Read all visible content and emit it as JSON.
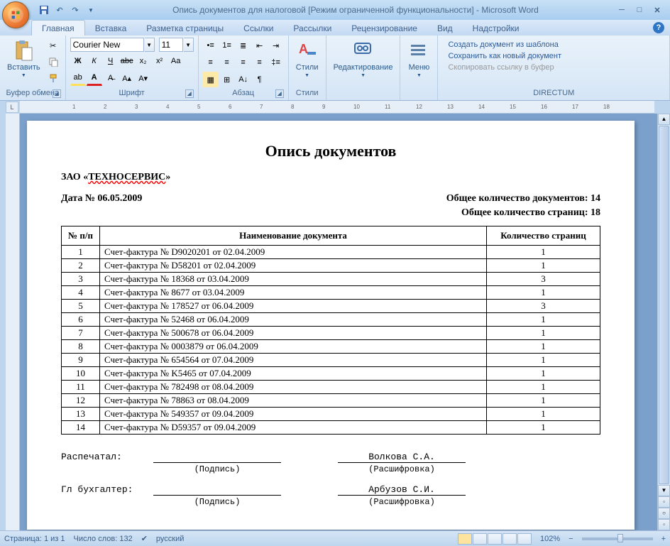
{
  "titlebar": {
    "title": "Опись документов для налоговой [Режим ограниченной функциональности] - Microsoft Word"
  },
  "tabs": {
    "items": [
      "Главная",
      "Вставка",
      "Разметка страницы",
      "Ссылки",
      "Рассылки",
      "Рецензирование",
      "Вид",
      "Надстройки"
    ],
    "active": 0
  },
  "ribbon": {
    "clipboard": {
      "label": "Буфер обмена",
      "paste": "Вставить"
    },
    "font": {
      "label": "Шрифт",
      "name": "Courier New",
      "size": "11"
    },
    "paragraph": {
      "label": "Абзац"
    },
    "styles": {
      "label": "Стили"
    },
    "editing": {
      "label": "Редактирование"
    },
    "menu": {
      "label": "Меню"
    },
    "directum": {
      "label": "DIRECTUM",
      "link1": "Создать документ из шаблона",
      "link2": "Сохранить как новый документ",
      "link3": "Скопировать ссылку в буфер"
    }
  },
  "document": {
    "title": "Опись документов",
    "company": "ЗАО «ТЕХНОСЕРВИС»",
    "date_label": "Дата № 06.05.2009",
    "docs_total": "Общее количество документов: 14",
    "pages_total": "Общее количество страниц: 18",
    "headers": {
      "n": "№ п/п",
      "name": "Наименование документа",
      "pages": "Количество страниц"
    },
    "rows": [
      {
        "n": "1",
        "name": "Счет-фактура № D9020201 от 02.04.2009",
        "pages": "1"
      },
      {
        "n": "2",
        "name": "Счет-фактура № D58201 от 02.04.2009",
        "pages": "1"
      },
      {
        "n": "3",
        "name": "Счет-фактура № 18368 от 03.04.2009",
        "pages": "3"
      },
      {
        "n": "4",
        "name": "Счет-фактура № 8677 от 03.04.2009",
        "pages": "1"
      },
      {
        "n": "5",
        "name": "Счет-фактура № 178527 от 06.04.2009",
        "pages": "3"
      },
      {
        "n": "6",
        "name": "Счет-фактура № 52468 от 06.04.2009",
        "pages": "1"
      },
      {
        "n": "7",
        "name": "Счет-фактура № 500678 от 06.04.2009",
        "pages": "1"
      },
      {
        "n": "8",
        "name": "Счет-фактура № 0003879 от 06.04.2009",
        "pages": "1"
      },
      {
        "n": "9",
        "name": "Счет-фактура № 654564 от 07.04.2009",
        "pages": "1"
      },
      {
        "n": "10",
        "name": "Счет-фактура № K5465 от 07.04.2009",
        "pages": "1"
      },
      {
        "n": "11",
        "name": "Счет-фактура № 782498 от 08.04.2009",
        "pages": "1"
      },
      {
        "n": "12",
        "name": "Счет-фактура № 78863 от 08.04.2009",
        "pages": "1"
      },
      {
        "n": "13",
        "name": "Счет-фактура № 549357 от 09.04.2009",
        "pages": "1"
      },
      {
        "n": "14",
        "name": "Счет-фактура № D59357 от 09.04.2009",
        "pages": "1"
      }
    ],
    "signatures": {
      "printed_by": "Распечатал:",
      "accountant": "Гл бухгалтер:",
      "sign_sub": "(Подпись)",
      "decode_sub": "(Расшифровка)",
      "name1": "Волкова С.А.",
      "name2": "Арбузов С.И."
    }
  },
  "statusbar": {
    "page": "Страница: 1 из 1",
    "words": "Число слов: 132",
    "lang": "русский",
    "zoom": "102%"
  }
}
